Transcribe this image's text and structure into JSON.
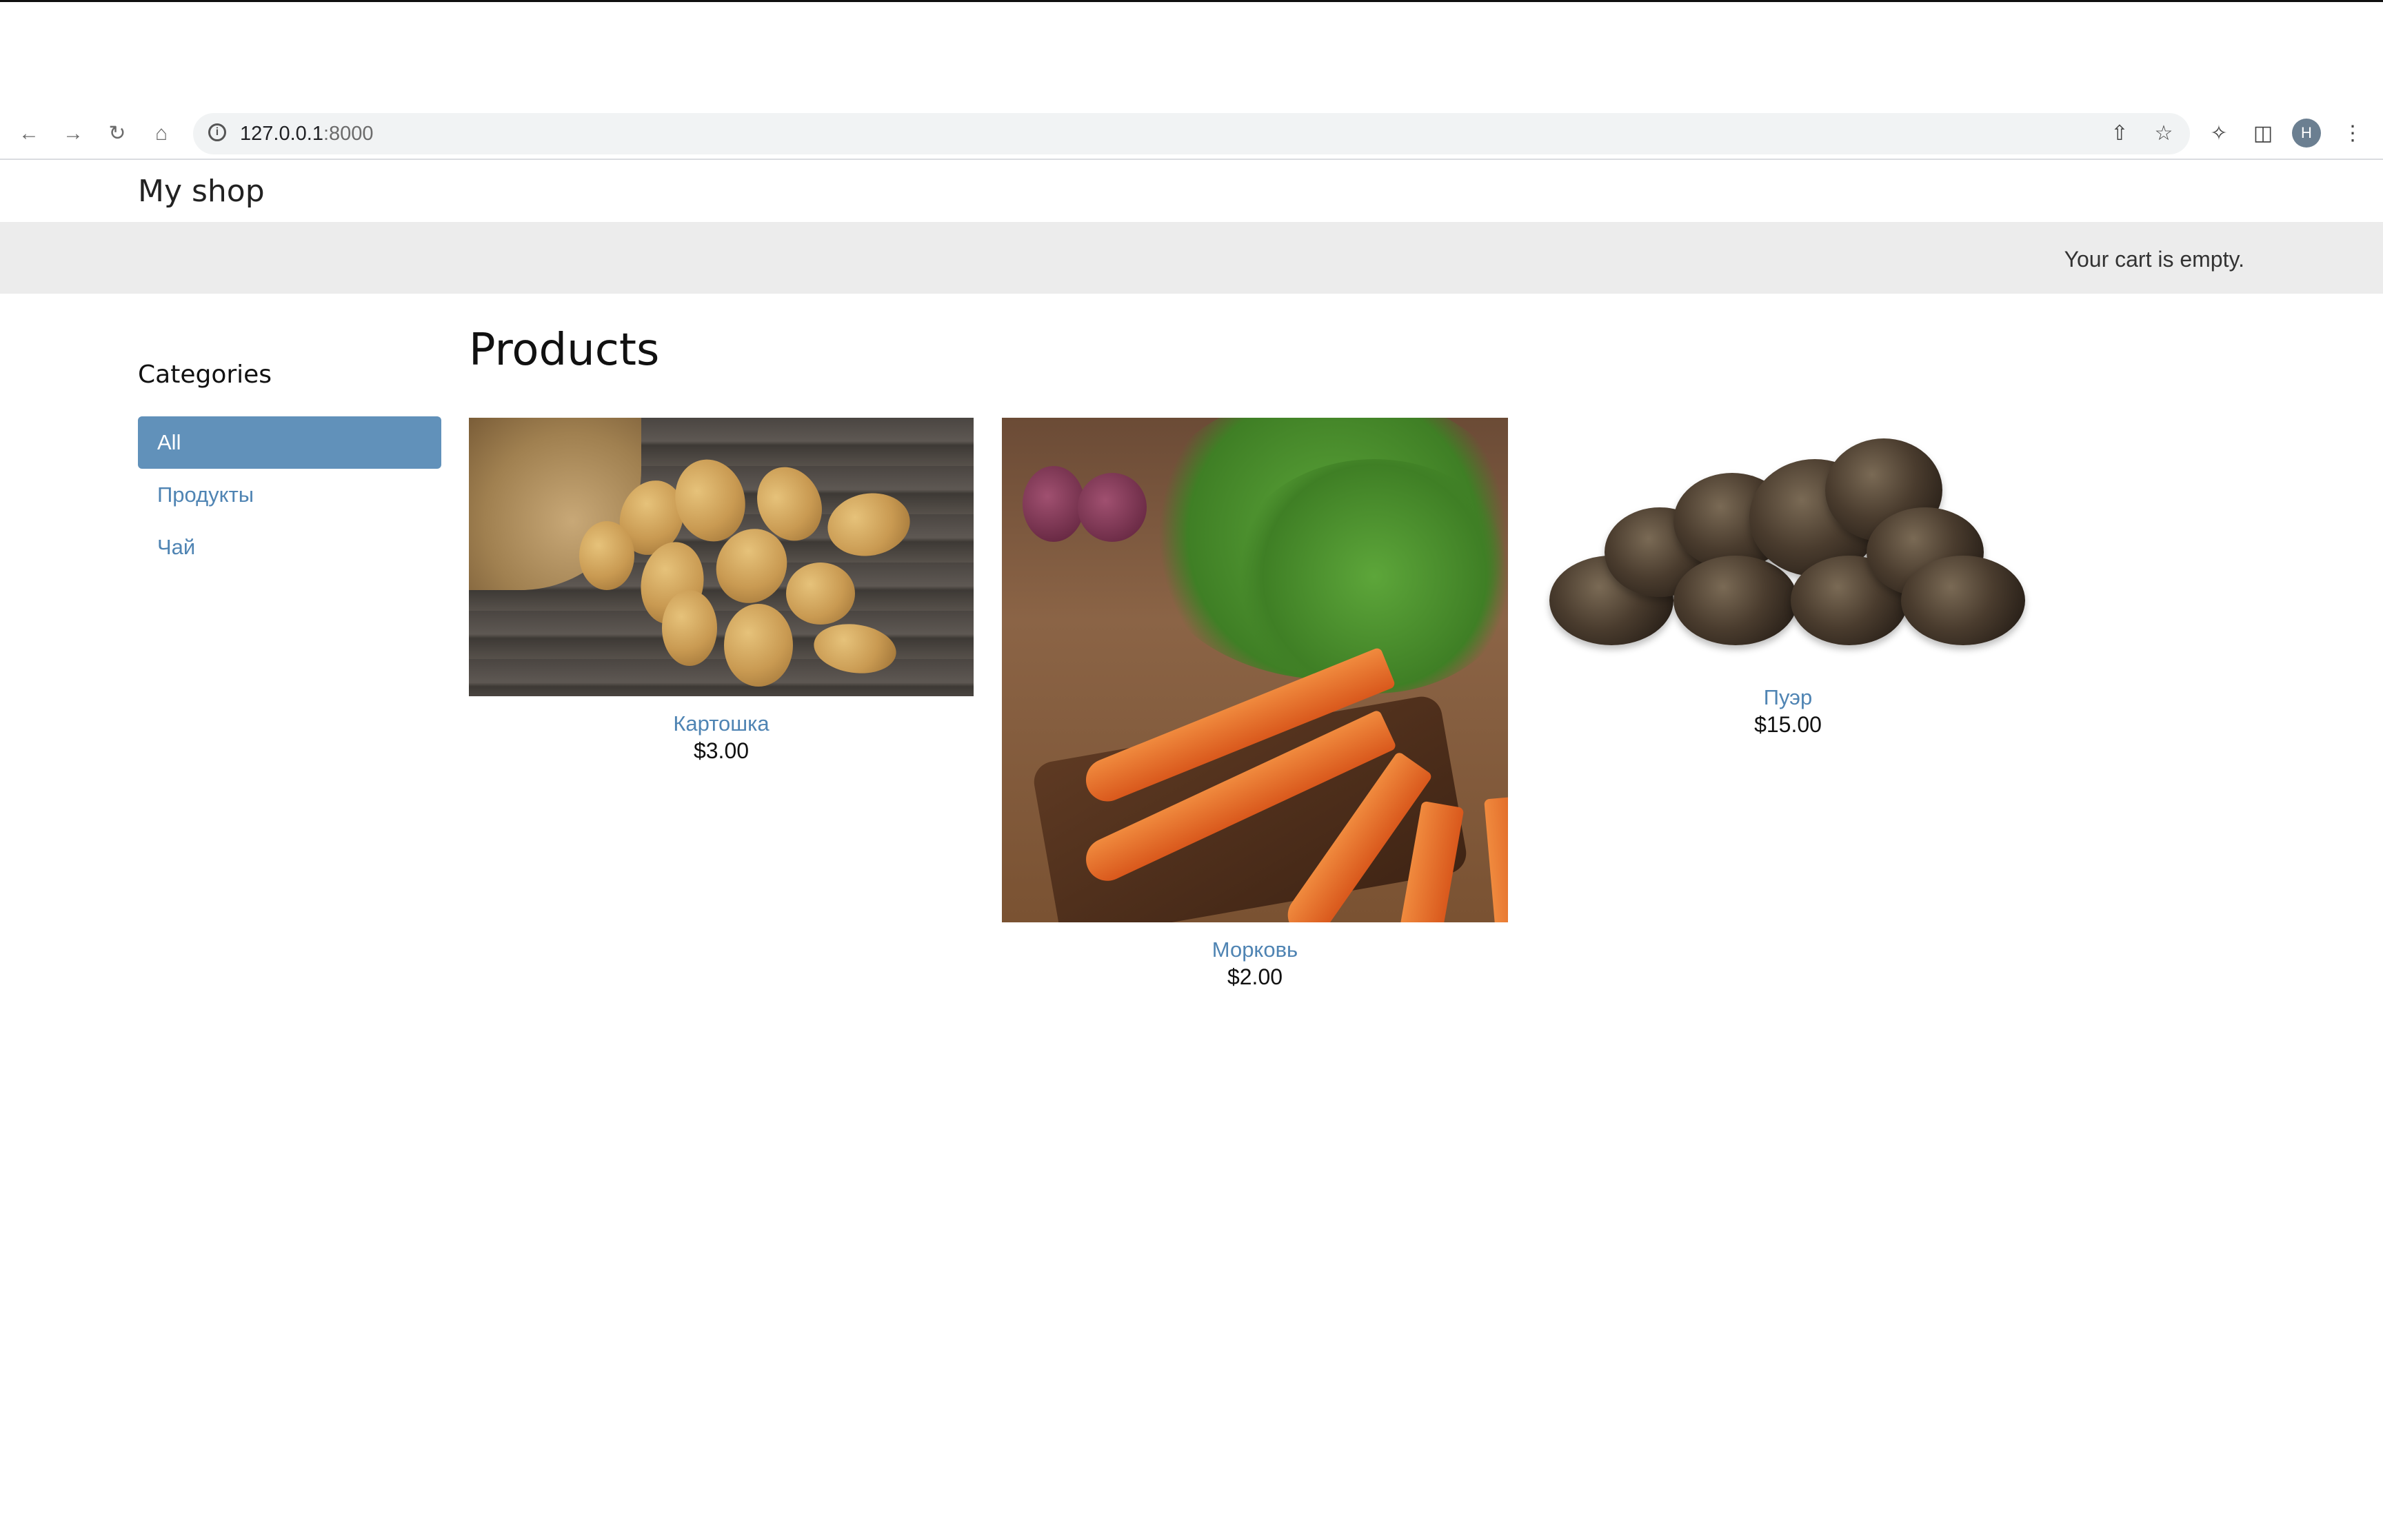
{
  "browser": {
    "url_host": "127.0.0.1",
    "url_port": ":8000",
    "avatar_letter": "H"
  },
  "header": {
    "brand": "My shop"
  },
  "cart": {
    "status": "Your cart is empty."
  },
  "sidebar": {
    "title": "Categories",
    "items": [
      {
        "label": "All",
        "active": true
      },
      {
        "label": "Продукты",
        "active": false
      },
      {
        "label": "Чай",
        "active": false
      }
    ]
  },
  "main": {
    "title": "Products",
    "products": [
      {
        "name": "Картошка",
        "price": "$3.00"
      },
      {
        "name": "Морковь",
        "price": "$2.00"
      },
      {
        "name": "Пуэр",
        "price": "$15.00"
      }
    ]
  },
  "colors": {
    "accent": "#6191ba",
    "link": "#4f84b3",
    "cart_bar": "#ececec"
  },
  "icons": [
    "back-arrow-icon",
    "forward-arrow-icon",
    "reload-icon",
    "home-icon",
    "site-info-icon",
    "share-icon",
    "bookmark-star-icon",
    "extensions-icon",
    "side-panel-icon",
    "menu-dots-icon"
  ]
}
